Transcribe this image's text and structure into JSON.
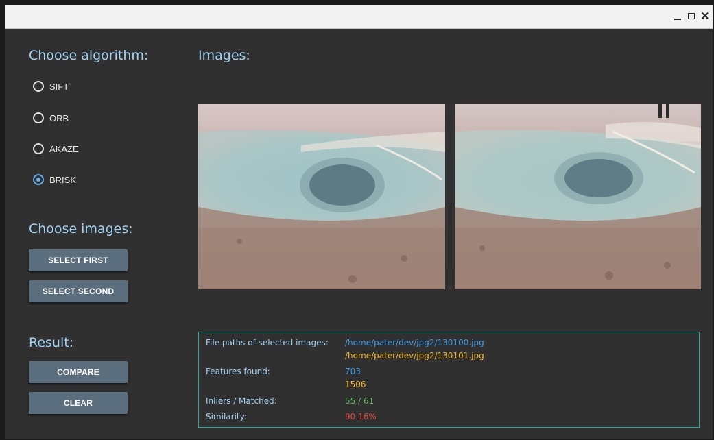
{
  "window": {
    "controls": {
      "minimize": "minimize-icon",
      "maximize": "maximize-icon",
      "close": "close-icon"
    }
  },
  "sidebar": {
    "algorithm_heading": "Choose algorithm:",
    "algorithms": [
      {
        "label": "SIFT",
        "checked": false
      },
      {
        "label": "ORB",
        "checked": false
      },
      {
        "label": "AKAZE",
        "checked": false
      },
      {
        "label": "BRISK",
        "checked": true
      }
    ],
    "images_heading": "Choose images:",
    "select_first_label": "SELECT FIRST",
    "select_second_label": "SELECT SECOND",
    "result_heading": "Result:",
    "compare_label": "COMPARE",
    "clear_label": "CLEAR"
  },
  "main": {
    "images_heading": "Images:"
  },
  "result": {
    "paths_label": "File paths of selected images:",
    "path_first": "/home/pater/dev/jpg2/130100.jpg",
    "path_second": "/home/pater/dev/jpg2/130101.jpg",
    "features_label": "Features found:",
    "features_first": "703",
    "features_second": "1506",
    "inliers_label": "Inliers / Matched:",
    "inliers_value": "55 / 61",
    "similarity_label": "Similarity:",
    "similarity_value": "90.16%"
  },
  "colors": {
    "accent": "#9fcff0",
    "border": "#2aa89a",
    "first": "#3e9be8",
    "second": "#f0b429",
    "inliers": "#5cb85c",
    "similarity": "#e0453a"
  }
}
